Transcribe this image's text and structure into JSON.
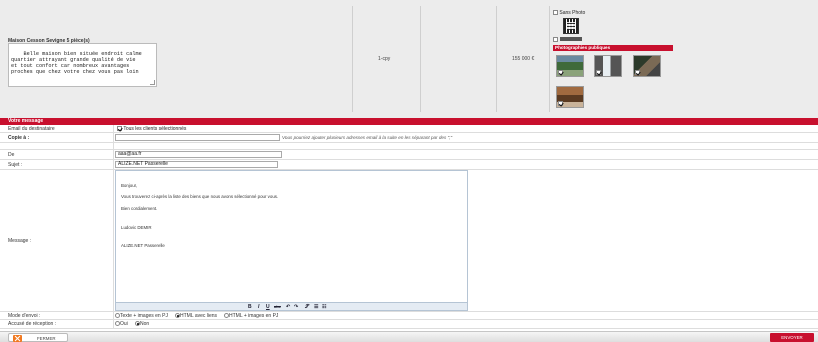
{
  "property": {
    "title": "Maison Cesson Sevigne 5 pièce(s)",
    "description": "Belle maison bien située endroit calme\nquartier attrayant grande qualité de vie\net tout confort car nombreux avantages\nproches que chez votre chez vous pas loin",
    "type": "1-cpy",
    "price": "155 000 €",
    "sans_photo_label": "Sans Photo",
    "photos_header": "Photographies publiques"
  },
  "message": {
    "section_title": "Votre message",
    "email_dest_label": "Email du destinataire",
    "email_dest_option": "Tous les clients sélectionnés",
    "copie_label": "Copie à :",
    "copie_hint": "Vous pourriez ajouter plusieurs adresses email à la suite en les séparant par des \";\"",
    "de_label": "De",
    "de_value": "aaa@aa.fr",
    "sujet_label": "Sujet :",
    "sujet_value": "ALIZE.NET Passerelle",
    "message_label": "Message :",
    "body": {
      "greeting": "Bonjour,",
      "line1": "Vous trouverez ci-après la liste des biens que nous avons sélectionné pour vous.",
      "line2": "Bien cordialement.",
      "signature_name": "Ludovic DEMIR",
      "signature_company": "ALIZE.NET Passerelle"
    },
    "toolbar_items": [
      "B",
      "I",
      "U",
      "abc",
      "↶",
      "↷",
      "𝒮",
      "☰",
      "☷"
    ],
    "mode_label": "Mode d'envoi :",
    "mode_options": [
      "Texte + images en PJ",
      "HTML avec liens",
      "HTML + images en PJ"
    ],
    "mode_selected": 1,
    "accuse_label": "Accusé de réception :",
    "accuse_options": [
      "Oui",
      "Non"
    ],
    "accuse_selected": 1
  },
  "footer": {
    "fermer_label": "FERMER",
    "envoyer_label": "ENVOYER"
  },
  "colors": {
    "accent": "#c8102e",
    "close_icon": "#f07820"
  }
}
